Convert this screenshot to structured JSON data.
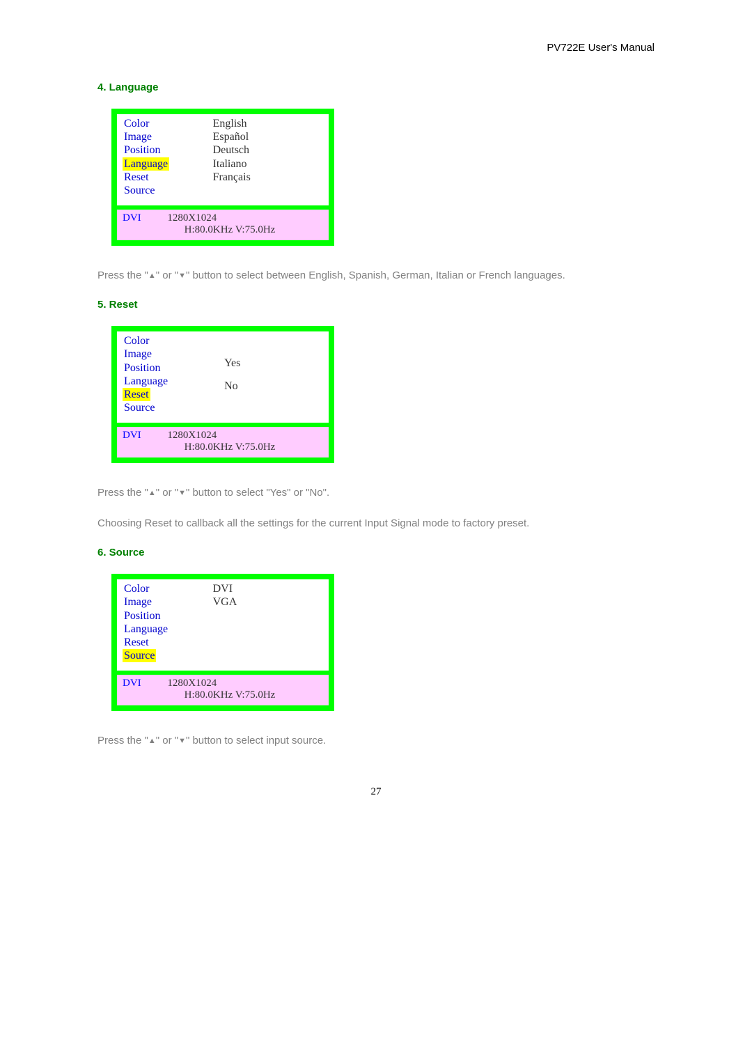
{
  "header": {
    "title": "PV722E User's Manual"
  },
  "page_number": "27",
  "sections": {
    "language": {
      "title": "4. Language",
      "menu_items": [
        "Color",
        "Image",
        "Position",
        "Language",
        "Reset",
        "Source"
      ],
      "highlight": "Language",
      "options": [
        "English",
        "Español",
        "Deutsch",
        "Italiano",
        "Français"
      ],
      "status": {
        "source": "DVI",
        "resolution": "1280X1024",
        "freq": "H:80.0KHz  V:75.0Hz"
      },
      "paragraph_a": "Press the \"",
      "paragraph_b": "\" or \"",
      "paragraph_c": "\" button to select between English, Spanish, German, Italian or French languages."
    },
    "reset": {
      "title": "5. Reset",
      "menu_items": [
        "Color",
        "Image",
        "Position",
        "Language",
        "Reset",
        "Source"
      ],
      "highlight": "Reset",
      "options": [
        "Yes",
        "No"
      ],
      "status": {
        "source": "DVI",
        "resolution": "1280X1024",
        "freq": "H:80.0KHz  V:75.0Hz"
      },
      "paragraph1_a": "Press the \"",
      "paragraph1_b": "\" or \"",
      "paragraph1_c": "\" button to select \"Yes\" or \"No\".",
      "paragraph2": "Choosing Reset to callback all the settings for the current Input Signal mode to factory preset."
    },
    "source": {
      "title": "6. Source",
      "menu_items": [
        "Color",
        "Image",
        "Position",
        "Language",
        "Reset",
        "Source"
      ],
      "highlight": "Source",
      "options": [
        "DVI",
        "VGA"
      ],
      "status": {
        "source": "DVI",
        "resolution": "1280X1024",
        "freq": "H:80.0KHz  V:75.0Hz"
      },
      "paragraph_a": "Press the \"",
      "paragraph_b": "\" or \"",
      "paragraph_c": "\" button to select input source."
    }
  },
  "triangles": {
    "up": "▲",
    "down": "▼"
  }
}
